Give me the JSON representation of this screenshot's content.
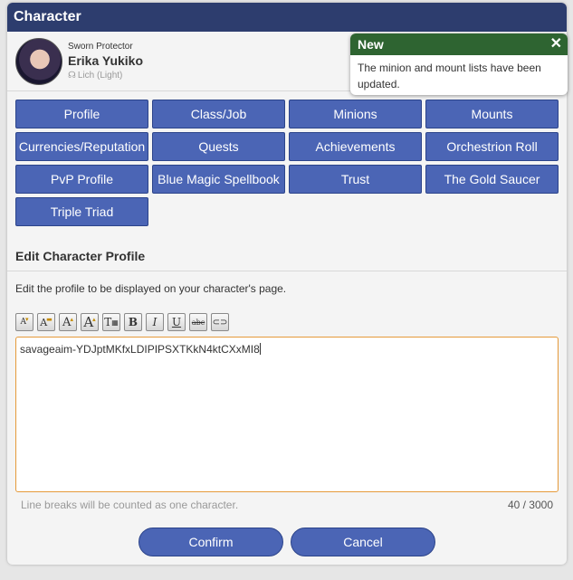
{
  "window": {
    "title": "Character"
  },
  "character": {
    "title": "Sworn Protector",
    "name": "Erika Yukiko",
    "world": "Lich (Light)",
    "world_icon": "world-icon"
  },
  "notification": {
    "title": "New",
    "close": "✕",
    "message": "The minion and mount lists have been updated."
  },
  "nav": {
    "buttons": [
      {
        "label": "Profile"
      },
      {
        "label": "Class/Job"
      },
      {
        "label": "Minions"
      },
      {
        "label": "Mounts"
      },
      {
        "label": "Currencies/Reputation"
      },
      {
        "label": "Quests"
      },
      {
        "label": "Achievements"
      },
      {
        "label": "Orchestrion Roll"
      },
      {
        "label": "PvP Profile"
      },
      {
        "label": "Blue Magic Spellbook"
      },
      {
        "label": "Trust"
      },
      {
        "label": "The Gold Saucer"
      },
      {
        "label": "Triple Triad"
      }
    ]
  },
  "editor_section": {
    "title": "Edit Character Profile",
    "description": "Edit the profile to be displayed on your character's page.",
    "toolbar_icons": [
      "font-size-small-icon",
      "font-size-normal-icon",
      "font-size-large-icon",
      "font-size-xlarge-icon",
      "text-table-icon",
      "bold-icon",
      "italic-icon",
      "underline-icon",
      "strikethrough-icon",
      "link-icon"
    ],
    "toolbar_glyphs": [
      "A",
      "A",
      "A",
      "A",
      "T",
      "B",
      "I",
      "U",
      "abc",
      "⊂⊃"
    ],
    "text": "savageaim-YDJptMKfxLDIPIPSXTKkN4ktCXxMI8",
    "hint": "Line breaks will be counted as one character.",
    "counter": "40 / 3000"
  },
  "actions": {
    "confirm": "Confirm",
    "cancel": "Cancel"
  },
  "colors": {
    "header": "#2d3d6e",
    "button": "#4b65b5",
    "notification": "#2e6431",
    "editor_border": "#e59a3a"
  }
}
